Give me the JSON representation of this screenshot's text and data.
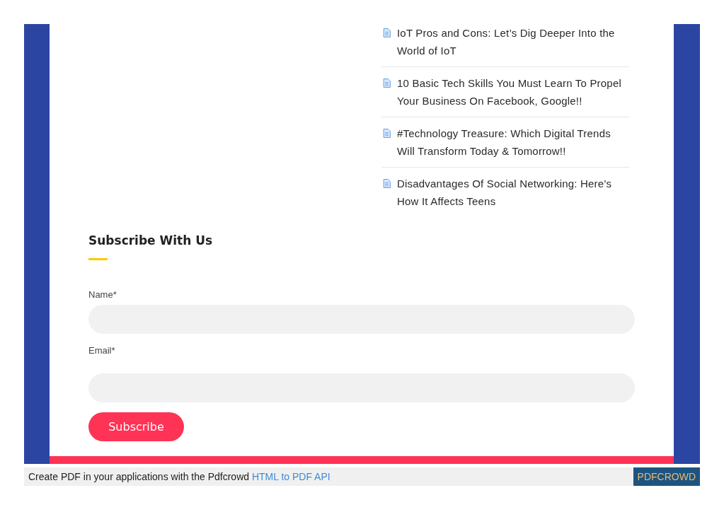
{
  "articles": [
    {
      "title": "IoT Pros and Cons: Let’s Dig Deeper Into the World of IoT"
    },
    {
      "title": "10 Basic Tech Skills You Must Learn To Propel Your Business On Facebook, Google!!"
    },
    {
      "title": "#Technology Treasure: Which Digital Trends Will Transform Today & Tomorrow!!"
    },
    {
      "title": "Disadvantages Of Social Networking: Here’s How It Affects Teens"
    }
  ],
  "subscribe": {
    "heading": "Subscribe With Us",
    "fields": [
      {
        "label": "Name*"
      },
      {
        "label": "Email*"
      }
    ],
    "button": "Subscribe"
  },
  "footer": {
    "text": "Create PDF in your applications with the Pdfcrowd",
    "link": "HTML to PDF API",
    "badge": "PDFCROWD"
  }
}
